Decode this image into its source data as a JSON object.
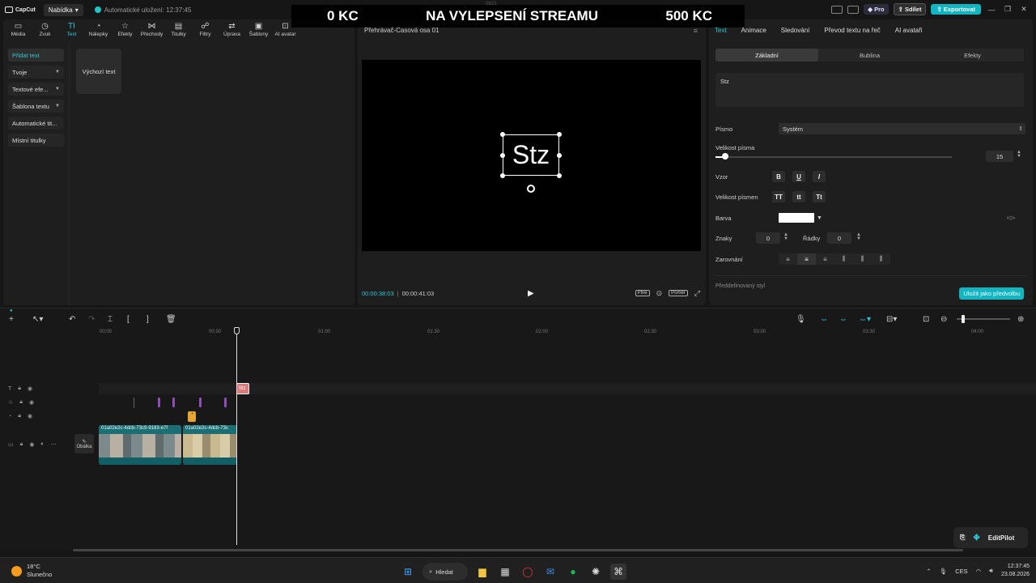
{
  "titlebar": {
    "app_name": "CapCut",
    "menu_label": "Nabídka",
    "autosave": "Automatické uložení: 12:37:45",
    "pro_label": "Pro",
    "share_label": "Sdílet",
    "export_label": "Exportovat"
  },
  "overlay": {
    "left": "0 KC",
    "center": "NA VYLEPSENÍ STREAMU",
    "right": "500 KC",
    "behind": "0823"
  },
  "toolbar": {
    "items": [
      {
        "label": "Média",
        "icon": "media-icon"
      },
      {
        "label": "Zvuk",
        "icon": "audio-icon"
      },
      {
        "label": "Text",
        "icon": "text-icon"
      },
      {
        "label": "Nálepky",
        "icon": "sticker-icon"
      },
      {
        "label": "Efekty",
        "icon": "effects-icon"
      },
      {
        "label": "Přechody",
        "icon": "transitions-icon"
      },
      {
        "label": "Titulky",
        "icon": "captions-icon"
      },
      {
        "label": "Filtry",
        "icon": "filters-icon"
      },
      {
        "label": "Úprava",
        "icon": "adjust-icon"
      },
      {
        "label": "Šablony",
        "icon": "templates-icon"
      },
      {
        "label": "AI avatar",
        "icon": "ai-avatar-icon"
      }
    ],
    "active_index": 2
  },
  "leftpanel": {
    "side_items": [
      {
        "label": "Přidat text",
        "chevron": false
      },
      {
        "label": "Tvoje",
        "chevron": true
      },
      {
        "label": "Textové efe...",
        "chevron": true
      },
      {
        "label": "Šablona textu",
        "chevron": true
      },
      {
        "label": "Automatické tit...",
        "chevron": false
      },
      {
        "label": "Místní titulky",
        "chevron": false
      }
    ],
    "card_label": "Výchozí text"
  },
  "player": {
    "title": "Přehrávač-Časová osa 01",
    "canvas_text": "Stz",
    "time_current": "00:00:38:03",
    "time_total": "00:00:41:03",
    "tag_full": "Plné",
    "tag_ratio": "Poměr"
  },
  "rightpanel": {
    "tabs": [
      "Text",
      "Animace",
      "Sledování",
      "Převod textu na řeč",
      "AI avataři"
    ],
    "subtabs": [
      "Základní",
      "Bublina",
      "Efekty"
    ],
    "text_value": "Stz",
    "font_label": "Písmo",
    "font_value": "Systém",
    "size_label": "Velikost písma",
    "size_value": "15",
    "size_fraction": 0.04,
    "style_label": "Vzor",
    "style_buttons": [
      "B",
      "U",
      "I"
    ],
    "case_label": "Velikost písmen",
    "case_buttons": [
      "TT",
      "tt",
      "Tt"
    ],
    "color_label": "Barva",
    "color_value": "#ffffff",
    "chars_label": "Znaky",
    "chars_value": "0",
    "lines_label": "Řádky",
    "lines_value": "0",
    "align_label": "Zarovnání",
    "cut_label": "Předdefinovaný styl",
    "save_preset": "Uložit jako předvolbu"
  },
  "timeline": {
    "ruler": [
      "00:00",
      "00:30",
      "01:00",
      "01:30",
      "02:00",
      "02:30",
      "03:00",
      "03:30",
      "04:00"
    ],
    "text_clip": "Stz",
    "clip1_label": "01a02e2c-4dcb-73c9-9183-e7f",
    "clip2_label": "01a02e2c-4dcb-73c",
    "cover_label": "Obálka",
    "editpilot": "EditPilot"
  },
  "taskbar": {
    "temp": "18°C",
    "weather": "Slunečno",
    "search": "Hledat",
    "lang": "CES",
    "time": "12:37:45",
    "date": "23.08.2026"
  },
  "colors": {
    "accent": "#2bc7d6",
    "export": "#12b5c2",
    "panel": "#1e1e1e"
  }
}
